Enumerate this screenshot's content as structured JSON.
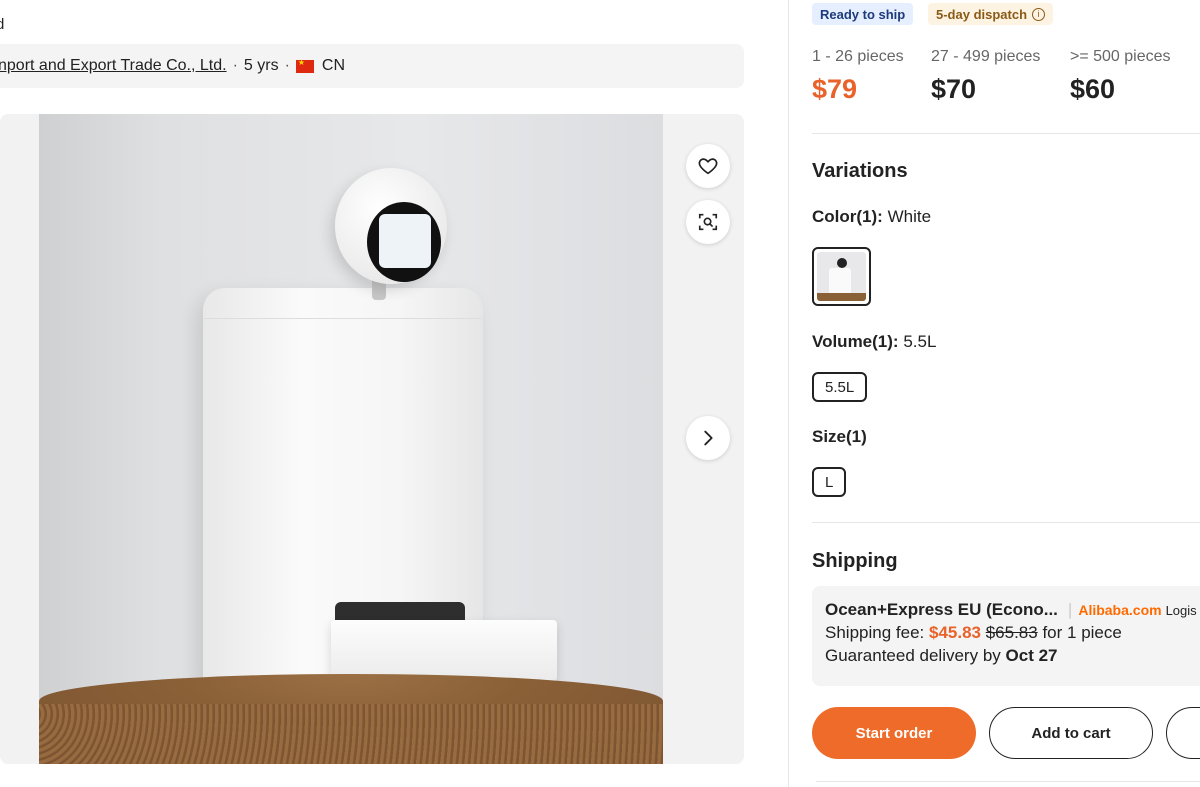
{
  "product": {
    "top_text": "d",
    "supplier_name": "nport and Export Trade Co., Ltd.",
    "supplier_years": "5 yrs",
    "supplier_country": "CN",
    "dot": "·"
  },
  "badges": {
    "ready_to_ship": "Ready to ship",
    "dispatch": "5-day dispatch",
    "dispatch_info_icon": "i"
  },
  "pricing": {
    "tiers": [
      {
        "range": "1 - 26 pieces",
        "price": "$79"
      },
      {
        "range": "27 - 499 pieces",
        "price": "$70"
      },
      {
        "range": ">= 500 pieces",
        "price": "$60"
      }
    ]
  },
  "variations": {
    "title": "Variations",
    "color_label": "Color(1):",
    "color_value": "White",
    "volume_label": "Volume(1):",
    "volume_value": "5.5L",
    "volume_option": "5.5L",
    "size_label": "Size(1)",
    "size_option": "L"
  },
  "shipping": {
    "title": "Shipping",
    "method": "Ocean+Express EU (Econo...",
    "separator": "|",
    "brand": "Alibaba.com",
    "brand_suffix": "Logis",
    "fee_label": "Shipping fee:",
    "fee": "$45.83",
    "old_fee": "$65.83",
    "fee_suffix": "for 1 piece",
    "delivery_label": "Guaranteed delivery by",
    "delivery_date": "Oct 27"
  },
  "actions": {
    "start_order": "Start order",
    "add_to_cart": "Add to cart"
  },
  "icons": {
    "favorite": "heart-icon",
    "visual_search": "image-search-icon",
    "next": "chevron-right-icon"
  },
  "colors": {
    "accent": "#e8622a",
    "primary_button": "#ef6b2a",
    "ready_badge_bg": "#e6efff",
    "dispatch_badge_bg": "#fdf3e2"
  }
}
